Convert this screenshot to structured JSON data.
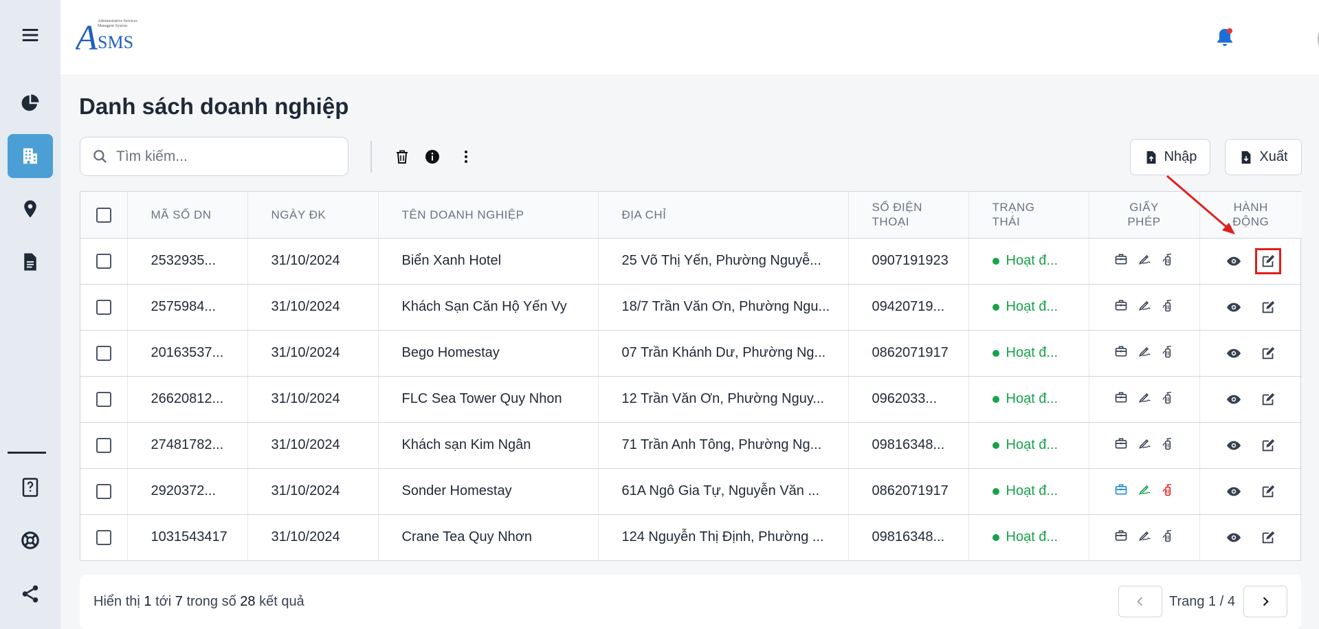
{
  "app": {
    "logo_text": "ASMS",
    "logo_subtitle": "Administrative Services Managent System"
  },
  "sidebar": {
    "items": [
      {
        "name": "menu-icon"
      },
      {
        "name": "dashboard-pie-icon"
      },
      {
        "name": "building-icon",
        "active": true
      },
      {
        "name": "location-pin-icon"
      },
      {
        "name": "document-icon"
      },
      {
        "name": "help-book-icon"
      },
      {
        "name": "lifebuoy-icon"
      },
      {
        "name": "share-icon"
      }
    ]
  },
  "page": {
    "title": "Danh sách doanh nghiệp"
  },
  "search": {
    "placeholder": "Tìm kiếm..."
  },
  "toolbar": {
    "import_label": "Nhập",
    "export_label": "Xuất"
  },
  "table": {
    "headers": {
      "code": "MÃ SỐ DN",
      "date": "NGÀY ĐK",
      "name": "TÊN DOANH NGHIỆP",
      "address": "ĐỊA CHỈ",
      "phone_line1": "SỐ ĐIỆN",
      "phone_line2": "THOẠI",
      "status_line1": "TRẠNG",
      "status_line2": "THÁI",
      "license_line1": "GIẤY",
      "license_line2": "PHÉP",
      "action_line1": "HÀNH",
      "action_line2": "ĐỘNG"
    },
    "rows": [
      {
        "code": "2532935...",
        "date": "31/10/2024",
        "name": "Biển Xanh Hotel",
        "address": "25 Võ Thị Yến, Phường Nguyễ...",
        "phone": "0907191923",
        "status": "Hoạt đ...",
        "license_colored": false
      },
      {
        "code": "2575984...",
        "date": "31/10/2024",
        "name": "Khách Sạn Căn Hộ Yến Vy",
        "address": "18/7 Trần Văn Ơn, Phường Ngu...",
        "phone": "09420719...",
        "status": "Hoạt đ...",
        "license_colored": false
      },
      {
        "code": "20163537...",
        "date": "31/10/2024",
        "name": "Bego Homestay",
        "address": "07 Trần Khánh Dư, Phường Ng...",
        "phone": "0862071917",
        "status": "Hoạt đ...",
        "license_colored": false
      },
      {
        "code": "26620812...",
        "date": "31/10/2024",
        "name": "FLC Sea Tower Quy Nhon",
        "address": "12 Trần Văn Ơn, Phường Nguy...",
        "phone": "0962033...",
        "status": "Hoạt đ...",
        "license_colored": false
      },
      {
        "code": "27481782...",
        "date": "31/10/2024",
        "name": "Khách sạn Kim Ngân",
        "address": "71 Trần Anh Tông, Phường Ng...",
        "phone": "09816348...",
        "status": "Hoạt đ...",
        "license_colored": false
      },
      {
        "code": "2920372...",
        "date": "31/10/2024",
        "name": "Sonder Homestay",
        "address": "61A Ngô Gia Tự, Nguyễn Văn ...",
        "phone": "0862071917",
        "status": "Hoạt đ...",
        "license_colored": true
      },
      {
        "code": "1031543417",
        "date": "31/10/2024",
        "name": "Crane Tea Quy Nhơn",
        "address": "124 Nguyễn Thị Định, Phường ...",
        "phone": "09816348...",
        "status": "Hoạt đ...",
        "license_colored": false
      }
    ]
  },
  "footer": {
    "prefix": "Hiển thị",
    "from": "1",
    "to_word": "tới",
    "to": "7",
    "of_word": "trong số",
    "total": "28",
    "suffix": "kết quả",
    "page_label": "Trang 1 / 4"
  },
  "colors": {
    "accent": "#4b9fd5",
    "status_green": "#16a34a",
    "annotation_red": "#e11d1d",
    "bell_blue": "#1e6fd9"
  }
}
